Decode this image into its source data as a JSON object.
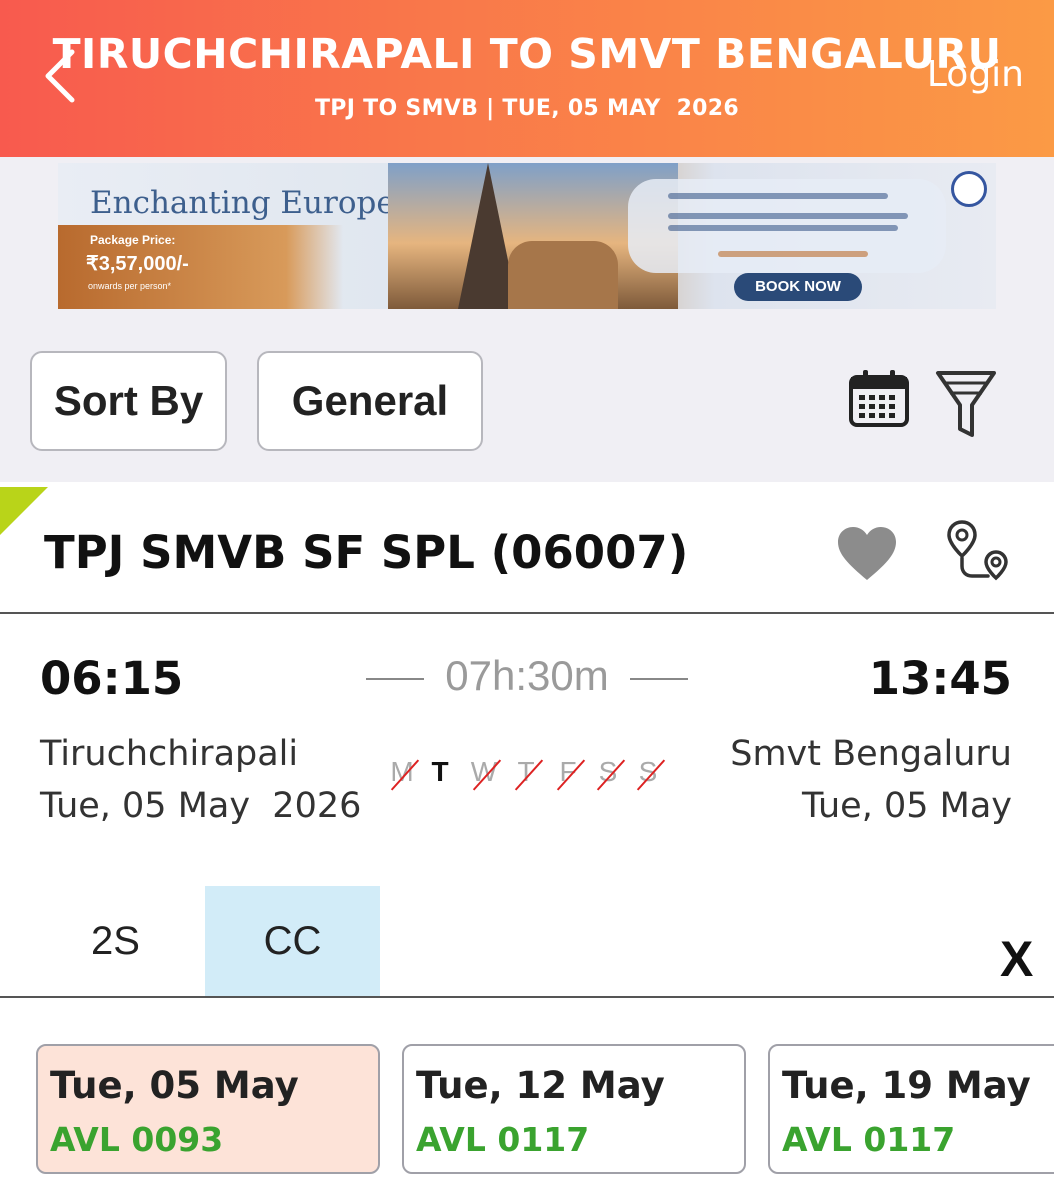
{
  "header": {
    "title": "TIRUCHCHIRAPALI TO SMVT BENGALURU",
    "subtitle": "TPJ TO SMVB | TUE, 05 MAY  2026",
    "login_label": "Login",
    "back_icon": "chevron-left-icon"
  },
  "ad": {
    "title": "Enchanting Europe",
    "price_label": "Package Price:",
    "price": "₹3,57,000/-",
    "price_note": "onwards per person*",
    "cta": "BOOK NOW"
  },
  "toolbar": {
    "sort_label": "Sort By",
    "quota_label": "General",
    "calendar_icon": "calendar-icon",
    "filter_icon": "filter-icon"
  },
  "train": {
    "name": "TPJ SMVB SF SPL (06007)",
    "favorite_icon": "heart-icon",
    "route_icon": "route-icon",
    "departure": {
      "time": "06:15",
      "station": "Tiruchchirapali",
      "date": "Tue, 05 May  2026"
    },
    "arrival": {
      "time": "13:45",
      "station": "Smvt Bengaluru",
      "date": "Tue, 05 May"
    },
    "duration": "07h:30m",
    "days": [
      {
        "label": "M",
        "runs": false
      },
      {
        "label": "T",
        "runs": true
      },
      {
        "label": "W",
        "runs": false
      },
      {
        "label": "T",
        "runs": false
      },
      {
        "label": "F",
        "runs": false
      },
      {
        "label": "S",
        "runs": false
      },
      {
        "label": "S",
        "runs": false
      }
    ],
    "classes": [
      {
        "label": "2S",
        "selected": false
      },
      {
        "label": "CC",
        "selected": true
      }
    ],
    "close_label": "X",
    "availability": [
      {
        "date": "Tue, 05 May",
        "status": "AVL 0093",
        "selected": true
      },
      {
        "date": "Tue, 12 May",
        "status": "AVL 0117",
        "selected": false
      },
      {
        "date": "Tue, 19 May",
        "status": "AVL 0117",
        "selected": false
      }
    ]
  },
  "colors": {
    "header_start": "#f85a4e",
    "header_end": "#fb9a45",
    "available": "#3aa32f",
    "selected_class": "#d2ecf8",
    "selected_date": "#fde3d8",
    "tag": "#b9d419",
    "cancel_strike": "#dd2222"
  }
}
